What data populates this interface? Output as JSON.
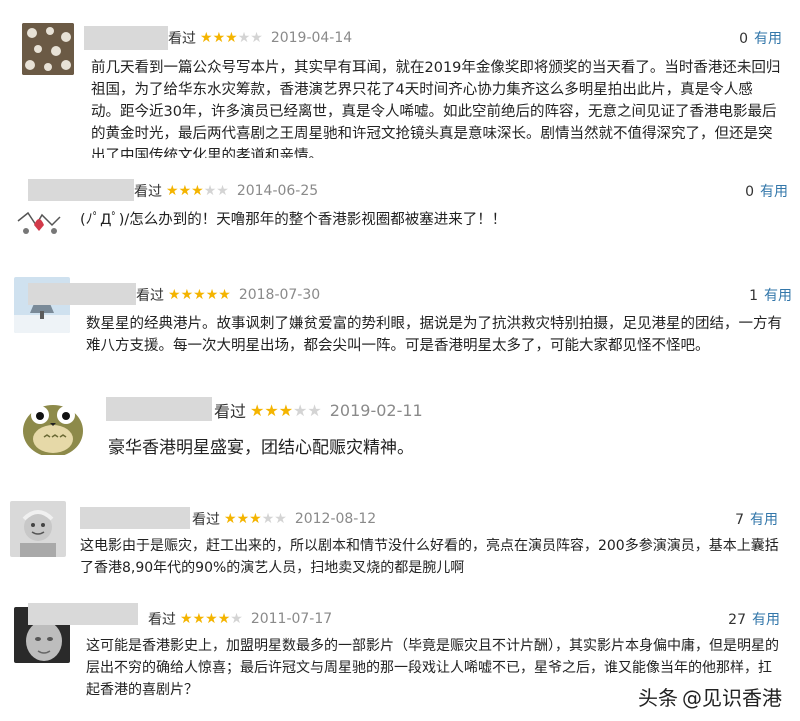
{
  "reviews": [
    {
      "status": "看过",
      "rating": 3,
      "date": "2019-04-14",
      "votes": "0",
      "useful_label": "有用",
      "content": "前几天看到一篇公众号写本片，其实早有耳闻，就在2019年金像奖即将颁奖的当天看了。当时香港还未回归祖国，为了给华东水灾筹款，香港演艺界只花了4天时间齐心协力集齐这么多明星拍出此片，真是令人感动。距今近30年，许多演员已经离世，真是令人唏嘘。如此空前绝后的阵容，无意之间见证了香港电影最后的黄金时光，最后两代喜剧之王周星驰和许冠文抢镜头真是意味深长。剧情当然就不值得深究了，但还是突出了中国传统文化里的孝道和亲情。"
    },
    {
      "status": "看过",
      "rating": 3,
      "date": "2014-06-25",
      "votes": "0",
      "useful_label": "有用",
      "content": "(ﾉﾟДﾟ)/怎么办到的！天噜那年的整个香港影视圈都被塞进来了！！"
    },
    {
      "status": "看过",
      "rating": 5,
      "date": "2018-07-30",
      "votes": "1",
      "useful_label": "有用",
      "content": "数星星的经典港片。故事讽刺了嫌贫爱富的势利眼，据说是为了抗洪救灾特别拍摄，足见港星的团结，一方有难八方支援。每一次大明星出场，都会尖叫一阵。可是香港明星太多了，可能大家都见怪不怪吧。"
    },
    {
      "status": "看过",
      "rating": 3,
      "date": "2019-02-11",
      "content": "豪华香港明星盛宴，团结心配赈灾精神。"
    },
    {
      "status": "看过",
      "rating": 3,
      "date": "2012-08-12",
      "votes": "7",
      "useful_label": "有用",
      "content": "这电影由于是赈灾，赶工出来的，所以剧本和情节没什么好看的，亮点在演员阵容，200多参演演员，基本上囊括了香港8,90年代的90%的演艺人员，扫地卖叉烧的都是腕儿啊"
    },
    {
      "status": "看过",
      "rating": 4,
      "date": "2011-07-17",
      "votes": "27",
      "useful_label": "有用",
      "content": "这可能是香港影史上，加盟明星数最多的一部影片（毕竟是赈灾且不计片酬），其实影片本身偏中庸，但是明星的层出不穷的确给人惊喜；最后许冠文与周星驰的那一段戏让人唏嘘不已，星爷之后，谁又能像当年的他那样，扛起香港的喜剧片？"
    }
  ],
  "watermark": {
    "prefix": "头条",
    "handle": "@见识香港"
  }
}
